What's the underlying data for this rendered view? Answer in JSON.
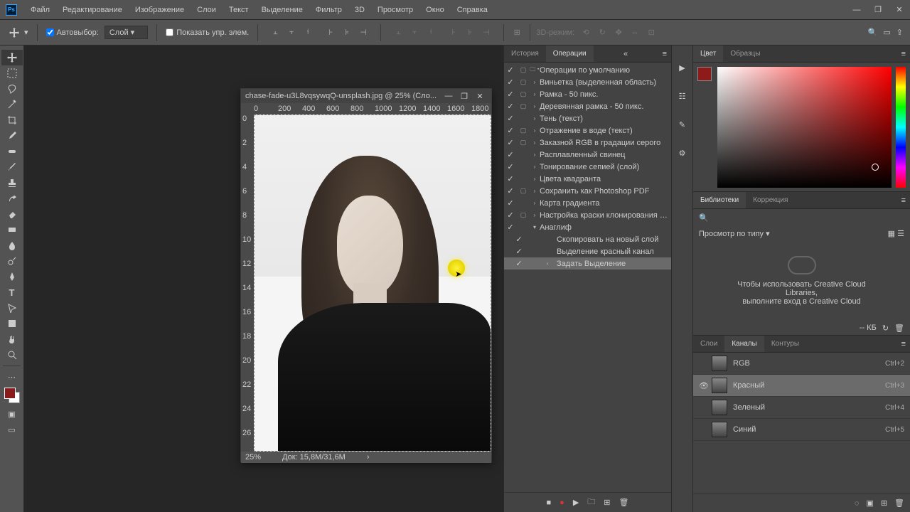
{
  "menu": [
    "Файл",
    "Редактирование",
    "Изображение",
    "Слои",
    "Текст",
    "Выделение",
    "Фильтр",
    "3D",
    "Просмотр",
    "Окно",
    "Справка"
  ],
  "options": {
    "autoselect": "Автовыбор:",
    "autoselect_target": "Слой",
    "show_controls": "Показать упр. элем.",
    "mode_label": "3D-режим:"
  },
  "doc": {
    "title": "chase-fade-u3L8vqsywqQ-unsplash.jpg @ 25% (Сло...",
    "zoom": "25%",
    "size": "Док: 15,8M/31,6M",
    "ruler_h": [
      "0",
      "200",
      "400",
      "600",
      "800",
      "1000",
      "1200",
      "1400",
      "1600",
      "1800"
    ],
    "ruler_v": [
      "0",
      "2",
      "4",
      "6",
      "8",
      "10",
      "12",
      "14",
      "16",
      "18",
      "20",
      "22",
      "24",
      "26"
    ]
  },
  "history_tab": "История",
  "actions_tab": "Операции",
  "actions": [
    {
      "chk": true,
      "box": true,
      "exp": "▾",
      "label": "Операции по умолчанию",
      "folder": true
    },
    {
      "chk": true,
      "box": true,
      "exp": "›",
      "label": "Виньетка (выделенная область)"
    },
    {
      "chk": true,
      "box": true,
      "exp": "›",
      "label": "Рамка - 50 пикс."
    },
    {
      "chk": true,
      "box": true,
      "exp": "›",
      "label": "Деревянная рамка - 50 пикс."
    },
    {
      "chk": true,
      "box": false,
      "exp": "›",
      "label": "Тень (текст)"
    },
    {
      "chk": true,
      "box": true,
      "exp": "›",
      "label": "Отражение в воде (текст)"
    },
    {
      "chk": true,
      "box": true,
      "exp": "›",
      "label": "Заказной RGB в градации серого"
    },
    {
      "chk": true,
      "box": false,
      "exp": "›",
      "label": "Расплавленный свинец"
    },
    {
      "chk": true,
      "box": false,
      "exp": "›",
      "label": "Тонирование сепией (слой)"
    },
    {
      "chk": true,
      "box": false,
      "exp": "›",
      "label": "Цвета квадранта"
    },
    {
      "chk": true,
      "box": true,
      "exp": "›",
      "label": "Сохранить как Photoshop PDF"
    },
    {
      "chk": true,
      "box": false,
      "exp": "›",
      "label": "Карта градиента"
    },
    {
      "chk": true,
      "box": true,
      "exp": "›",
      "label": "Настройка краски клонирования д..."
    },
    {
      "chk": true,
      "box": false,
      "exp": "▾",
      "label": "Анаглиф"
    }
  ],
  "action_steps": [
    {
      "chk": true,
      "label": "Скопировать на новый слой"
    },
    {
      "chk": true,
      "label": "Выделение красный канал"
    },
    {
      "chk": true,
      "label": "Задать Выделение",
      "selected": true,
      "exp": "›"
    }
  ],
  "color_tab": "Цвет",
  "samples_tab": "Образцы",
  "lib": {
    "tab1": "Библиотеки",
    "tab2": "Коррекция",
    "view": "Просмотр по типу",
    "msg1": "Чтобы использовать Creative Cloud",
    "msg2": "Libraries,",
    "msg3": "выполните вход в Creative Cloud",
    "size": "-- КБ"
  },
  "channels": {
    "tab_layers": "Слои",
    "tab_channels": "Каналы",
    "tab_paths": "Контуры",
    "rows": [
      {
        "name": "RGB",
        "shortcut": "Ctrl+2",
        "visible": false
      },
      {
        "name": "Красный",
        "shortcut": "Ctrl+3",
        "visible": true,
        "selected": true
      },
      {
        "name": "Зеленый",
        "shortcut": "Ctrl+4",
        "visible": false
      },
      {
        "name": "Синий",
        "shortcut": "Ctrl+5",
        "visible": false
      }
    ]
  }
}
